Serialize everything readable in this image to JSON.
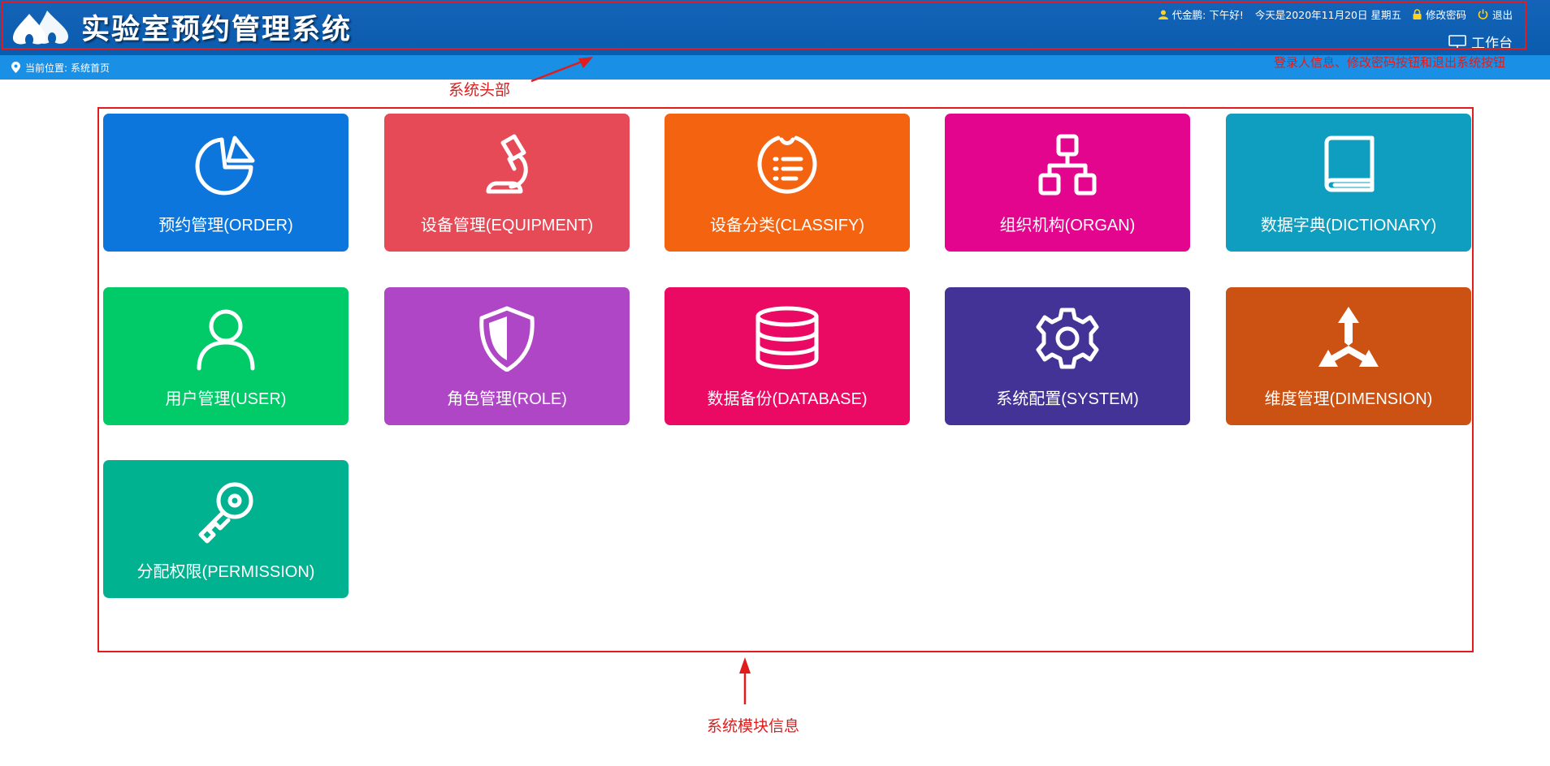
{
  "header": {
    "title": "实验室预约管理系统",
    "user": "代金鹏: 下午好!",
    "date": "今天是2020年11月20日 星期五",
    "change_password": "修改密码",
    "logout": "退出",
    "workbench": "工作台"
  },
  "breadcrumb": {
    "prefix": "当前位置:",
    "page": "系统首页"
  },
  "annotations": {
    "header_label": "系统头部",
    "user_info_label": "登录人信息、修改密码按钮和退出系统按钮",
    "modules_label": "系统模块信息"
  },
  "modules": [
    {
      "label": "预约管理(ORDER)",
      "color": "#0c76dd",
      "icon": "pie-chart-icon"
    },
    {
      "label": "设备管理(EQUIPMENT)",
      "color": "#e64a57",
      "icon": "microscope-icon"
    },
    {
      "label": "设备分类(CLASSIFY)",
      "color": "#f4630f",
      "icon": "list-circle-icon"
    },
    {
      "label": "组织机构(ORGAN)",
      "color": "#e3058d",
      "icon": "org-chart-icon"
    },
    {
      "label": "数据字典(DICTIONARY)",
      "color": "#0f9ebf",
      "icon": "book-icon"
    },
    {
      "label": "用户管理(USER)",
      "color": "#00cb68",
      "icon": "user-icon"
    },
    {
      "label": "角色管理(ROLE)",
      "color": "#ae46c5",
      "icon": "shield-icon"
    },
    {
      "label": "数据备份(DATABASE)",
      "color": "#eb0a63",
      "icon": "database-icon"
    },
    {
      "label": "系统配置(SYSTEM)",
      "color": "#433396",
      "icon": "gear-icon"
    },
    {
      "label": "维度管理(DIMENSION)",
      "color": "#cc5213",
      "icon": "three-arrows-icon"
    },
    {
      "label": "分配权限(PERMISSION)",
      "color": "#01b291",
      "icon": "key-icon"
    }
  ]
}
